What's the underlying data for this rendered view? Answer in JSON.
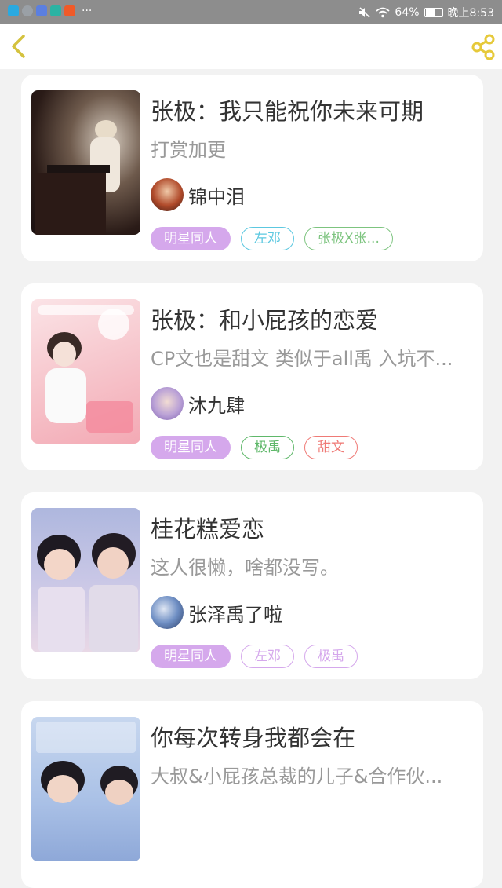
{
  "status_bar": {
    "battery": "64%",
    "time": "晚上8:53",
    "dots": "···",
    "app_icons": [
      "shield-app-icon",
      "qq-icon",
      "music-app-icon",
      "phone-app-icon",
      "red-app-icon"
    ]
  },
  "app_bar": {
    "back_icon": "chevron-left-icon",
    "share_icon": "share-icon"
  },
  "colors": {
    "accent": "#d5a8ec",
    "back_icon": "#d4c23e",
    "share_icon": "#e6c93a"
  },
  "books": [
    {
      "title": "张极：我只能祝你未来可期",
      "description": "打赏加更",
      "author": "锦中泪",
      "tags": [
        {
          "label": "明星同人",
          "color": "#d5a8ec",
          "filled": true
        },
        {
          "label": "左邓",
          "color": "#5cc8e0",
          "filled": false
        },
        {
          "label": "张极X张...",
          "color": "#7dc47f",
          "filled": false
        }
      ]
    },
    {
      "title": "张极：和小屁孩的恋爱",
      "description": "CP文也是甜文 类似于all禹 入坑不...",
      "author": "沐九肆",
      "tags": [
        {
          "label": "明星同人",
          "color": "#d5a8ec",
          "filled": true
        },
        {
          "label": "极禹",
          "color": "#5fb86a",
          "filled": false
        },
        {
          "label": "甜文",
          "color": "#ef7a76",
          "filled": false
        }
      ]
    },
    {
      "title": "桂花糕爱恋",
      "description": "这人很懒，啥都没写。",
      "author": "张泽禹了啦",
      "tags": [
        {
          "label": "明星同人",
          "color": "#d5a8ec",
          "filled": true
        },
        {
          "label": "左邓",
          "color": "#d5a8ec",
          "filled": false
        },
        {
          "label": "极禹",
          "color": "#d5a8ec",
          "filled": false
        }
      ]
    },
    {
      "title": "你每次转身我都会在",
      "description": "大叔&小屁孩总裁的儿子&合作伙...",
      "author": "",
      "tags": []
    }
  ]
}
